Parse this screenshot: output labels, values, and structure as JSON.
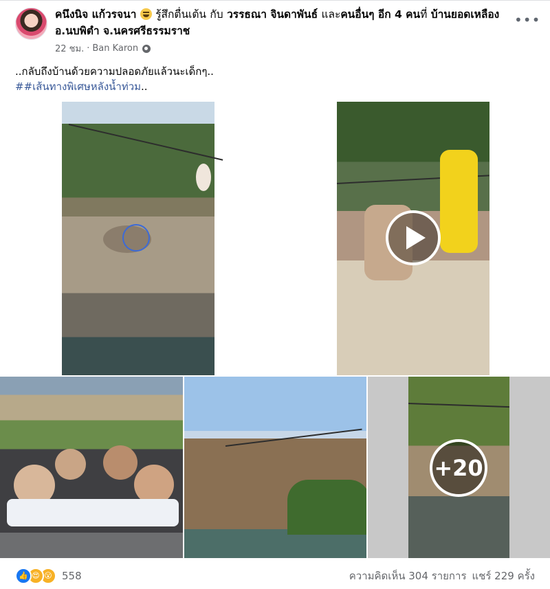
{
  "post": {
    "author": "คนึงนิจ แก้วรจนา",
    "feeling": "รู้สึกตื่นเต้น",
    "with_word": "กับ",
    "tagged": "วรรธณา จินดาพันธ์",
    "and_word": "และ",
    "others": "คนอื่นๆ อีก 4 คน",
    "at_word": "ที่",
    "location": "บ้านยอดเหลือง อ.นบพิตำ จ.นครศรีธรรมราช",
    "time": "22 ชม.",
    "separator": "·",
    "place": "Ban Karon",
    "more_button": "•••",
    "text_line1": "..กลับถึงบ้านด้วยความปลอดภัยแล้วนะเด็กๆ..",
    "hashtag_prefix": "#",
    "hashtag": "#เส้นทางพิเศษหลังน้ำท่วม",
    "hashtag_suffix": ".."
  },
  "media": {
    "more_count": "+20"
  },
  "footer": {
    "reaction_count": "558",
    "comments": "ความคิดเห็น 304 รายการ",
    "shares": "แชร์ 229 ครั้ง"
  },
  "colors": {
    "link": "#385898",
    "meta": "#65676b",
    "like": "#1877f2"
  },
  "icons": [
    "avatar",
    "grinning-emoji-icon",
    "globe-icon",
    "more-icon",
    "play-icon",
    "like-icon",
    "love-icon",
    "wow-icon"
  ]
}
